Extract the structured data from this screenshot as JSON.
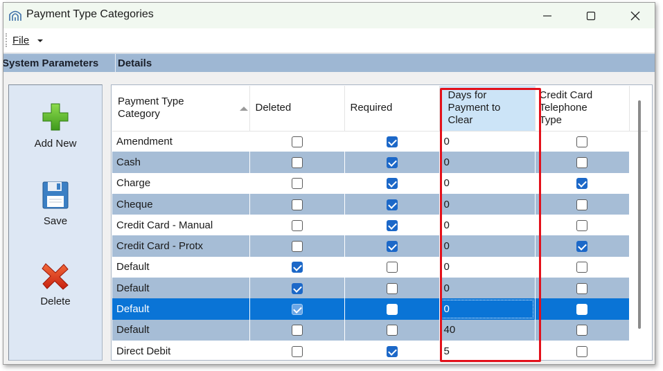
{
  "window": {
    "title": "Payment Type Categories"
  },
  "icons": {
    "app": "app-logo-icon",
    "minimize": "minimize-icon",
    "maximize": "maximize-icon",
    "close": "close-icon",
    "add": "green-plus-icon",
    "save": "floppy-disk-icon",
    "delete": "red-x-icon"
  },
  "menu": {
    "file": "File"
  },
  "tabs": {
    "system": "System Parameters",
    "details": "Details"
  },
  "actions": {
    "add_new": "Add New",
    "save": "Save",
    "delete": "Delete"
  },
  "colors": {
    "row_alt": "#a6bdd6",
    "row_selected": "#0a74d6",
    "highlight_border": "#e3101a",
    "checkbox_checked": "#1c68c8"
  },
  "grid": {
    "columns": {
      "category_line1": "Payment Type",
      "category_line2": "Category",
      "deleted": "Deleted",
      "required": "Required",
      "days_line1": "Days for",
      "days_line2": "Payment to",
      "days_line3": "Clear",
      "cc_line1": "Credit Card",
      "cc_line2": "Telephone",
      "cc_line3": "Type"
    },
    "rows": [
      {
        "category": "Amendment",
        "deleted": false,
        "required": true,
        "days": "0",
        "cc_phone": false
      },
      {
        "category": "Cash",
        "deleted": false,
        "required": true,
        "days": "0",
        "cc_phone": false
      },
      {
        "category": "Charge",
        "deleted": false,
        "required": true,
        "days": "0",
        "cc_phone": true
      },
      {
        "category": "Cheque",
        "deleted": false,
        "required": true,
        "days": "0",
        "cc_phone": false
      },
      {
        "category": "Credit Card - Manual",
        "deleted": false,
        "required": true,
        "days": "0",
        "cc_phone": false
      },
      {
        "category": "Credit Card - Protx",
        "deleted": false,
        "required": true,
        "days": "0",
        "cc_phone": true
      },
      {
        "category": "Default",
        "deleted": true,
        "required": false,
        "days": "0",
        "cc_phone": false
      },
      {
        "category": "Default",
        "deleted": true,
        "required": false,
        "days": "0",
        "cc_phone": false
      },
      {
        "category": "Default",
        "deleted": true,
        "required": false,
        "days": "0",
        "cc_phone": false,
        "selected": true
      },
      {
        "category": "Default",
        "deleted": false,
        "required": false,
        "days": "40",
        "cc_phone": false
      },
      {
        "category": "Direct Debit",
        "deleted": false,
        "required": true,
        "days": "5",
        "cc_phone": false
      }
    ]
  }
}
